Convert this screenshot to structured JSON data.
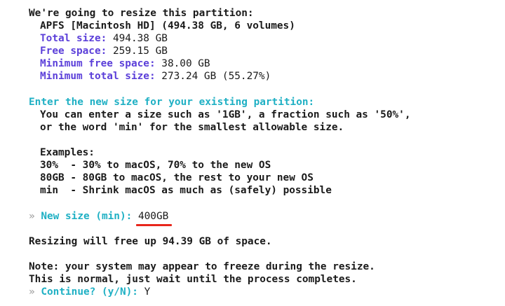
{
  "intro": {
    "heading": "We're going to resize this partition:",
    "partition": "APFS [Macintosh HD] (494.38 GB, 6 volumes)",
    "stats": [
      {
        "label": "Total size:",
        "value": " 494.38 GB"
      },
      {
        "label": "Free space:",
        "value": " 259.15 GB"
      },
      {
        "label": "Minimum free space:",
        "value": " 38.00 GB"
      },
      {
        "label": "Minimum total size:",
        "value": " 273.24 GB (55.27%)"
      }
    ]
  },
  "prompt": {
    "heading": "Enter the new size for your existing partition:",
    "help1": "You can enter a size such as '1GB', a fraction such as '50%',",
    "help2": "or the word 'min' for the smallest allowable size.",
    "examples_title": "Examples:",
    "examples": [
      {
        "key": "30%",
        "desc": "  - 30% to macOS, 70% to the new OS"
      },
      {
        "key": "80GB",
        "desc": " - 80GB to macOS, the rest to your new OS"
      },
      {
        "key": "min",
        "desc": "  - Shrink macOS as much as (safely) possible"
      }
    ]
  },
  "input": {
    "marker": "»",
    "label": "New size (min):",
    "value": "400GB"
  },
  "result": "Resizing will free up 94.39 GB of space.",
  "note": {
    "line1": "Note: your system may appear to freeze during the resize.",
    "line2": "This is normal, just wait until the process completes."
  },
  "confirm": {
    "marker": "»",
    "label": "Continue? (y/N):",
    "value": "Y"
  }
}
